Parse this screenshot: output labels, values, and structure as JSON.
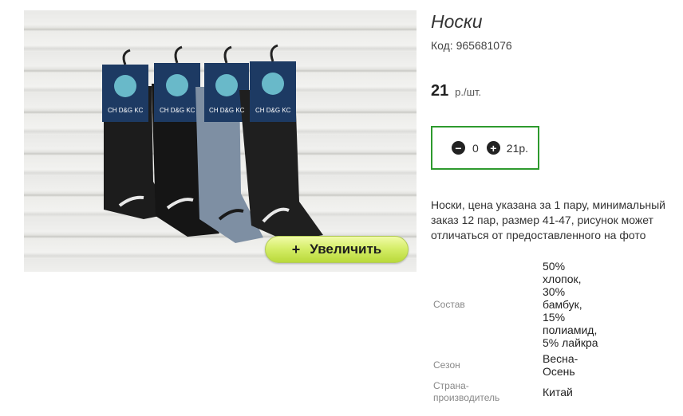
{
  "product": {
    "title": "Носки",
    "code_label": "Код:",
    "code": "965681076",
    "price_value": "21",
    "price_unit": "р./шт.",
    "description": "Носки, цена указана за 1 пару, минимальный заказ 12 пар, размер 41-47, рисунок может отличаться от предоставленного на фото"
  },
  "gallery": {
    "zoom_plus": "+",
    "zoom_label": "Увеличить",
    "sock_brand": "CH D&G KC",
    "sock_colors": [
      "#1c1c1c",
      "#151515",
      "#7e8fa3",
      "#1f1f1f"
    ]
  },
  "quantity": {
    "minus": "−",
    "value": "0",
    "plus": "+",
    "sum": "21р."
  },
  "specs": [
    {
      "label": "Состав",
      "value": "50% хлопок, 30% бамбук, 15% полиамид, 5% лайкра"
    },
    {
      "label": "Сезон",
      "value": "Весна-Осень"
    },
    {
      "label": "Страна-производитель",
      "value": "Китай"
    }
  ],
  "colors": {
    "qty_border": "#2e9a2e",
    "zoom_button": "#d6ee6a"
  }
}
